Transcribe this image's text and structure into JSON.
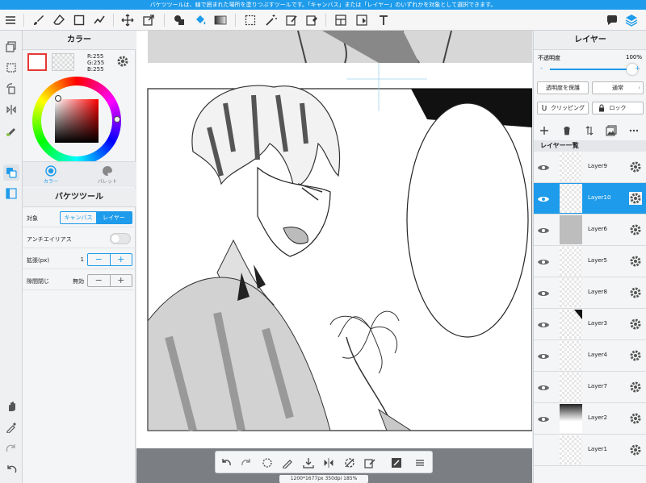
{
  "status_message": "バケツツールは、線で囲まれた場所を塗りつぶすツールです。「キャンバス」または「レイヤー」のいずれかを対象として選択できます。",
  "color_panel": {
    "title": "カラー",
    "r": "R:255",
    "g": "G:255",
    "b": "B:255",
    "main_color": "#ffffff",
    "tabs": [
      "カラー",
      "パレット"
    ]
  },
  "bucket_panel": {
    "title": "バケツツール",
    "target_label": "対象",
    "target_options": [
      "キャンバス",
      "レイヤー"
    ],
    "target_selected": "レイヤー",
    "antialias_label": "アンチエイリアス",
    "expand_label": "拡張(px)",
    "expand_value": "1",
    "gap_label": "隙間閉じ",
    "gap_value": "無効",
    "minus": "−",
    "plus": "+"
  },
  "canvas_info": "1200*1677px 350dpi 185%",
  "layer_panel": {
    "title": "レイヤー",
    "opacity_label": "不透明度",
    "opacity_value": "100%",
    "opacity_level": 1.0,
    "minus": "-",
    "plus": "+",
    "protect_button": "透明度を保護",
    "blend_button": "通常",
    "clipping_button": "クリッピング",
    "lock_button": "ロック",
    "list_title": "レイヤー一覧",
    "layers": [
      {
        "name": "Layer9",
        "selected": false
      },
      {
        "name": "Layer10",
        "selected": true
      },
      {
        "name": "Layer6",
        "selected": false
      },
      {
        "name": "Layer5",
        "selected": false
      },
      {
        "name": "Layer8",
        "selected": false
      },
      {
        "name": "Layer3",
        "selected": false
      },
      {
        "name": "Layer4",
        "selected": false
      },
      {
        "name": "Layer7",
        "selected": false
      },
      {
        "name": "Layer2",
        "selected": false
      },
      {
        "name": "Layer1",
        "selected": false
      }
    ]
  },
  "colors": {
    "accent": "#1e9bea",
    "main_swatch_border": "#e53935"
  }
}
